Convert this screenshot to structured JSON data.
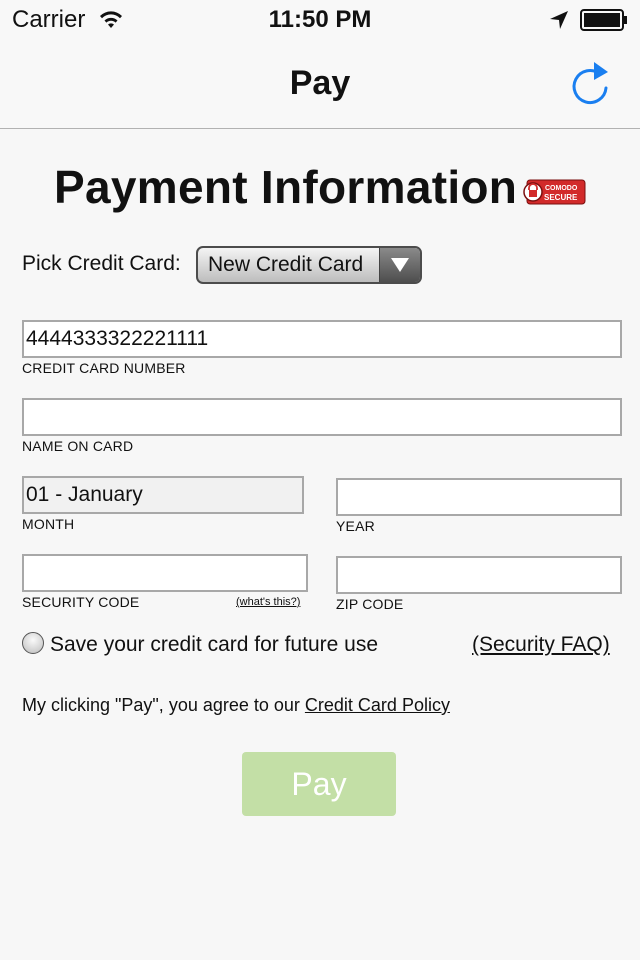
{
  "status_bar": {
    "carrier": "Carrier",
    "time": "11:50 PM"
  },
  "nav": {
    "title": "Pay",
    "refresh_icon": "refresh-icon"
  },
  "content": {
    "heading": "Payment Information",
    "badge_text_top": "COMODO",
    "badge_text_bottom": "SECURE",
    "pick_label": "Pick Credit Card:",
    "card_select_value": "New Credit Card",
    "card_number_value": "4444333322221111",
    "card_number_caption": "CREDIT CARD NUMBER",
    "name_value": "",
    "name_caption": "NAME ON CARD",
    "month_value": "01 - January",
    "month_caption": "MONTH",
    "year_value": "",
    "year_caption": "YEAR",
    "security_value": "",
    "security_caption": "SECURITY CODE",
    "whats_this": "(what's this?)",
    "zip_value": "",
    "zip_caption": "ZIP CODE",
    "save_label": "Save your credit card for future use",
    "security_faq": "(Security FAQ)",
    "agree_prefix": "My clicking \"Pay\", you agree to our ",
    "policy_link": "Credit Card Policy",
    "pay_button": "Pay"
  },
  "colors": {
    "accent": "#1a7ff0",
    "pay_button_bg": "#c3dfa6",
    "badge_red": "#d22a2a"
  }
}
